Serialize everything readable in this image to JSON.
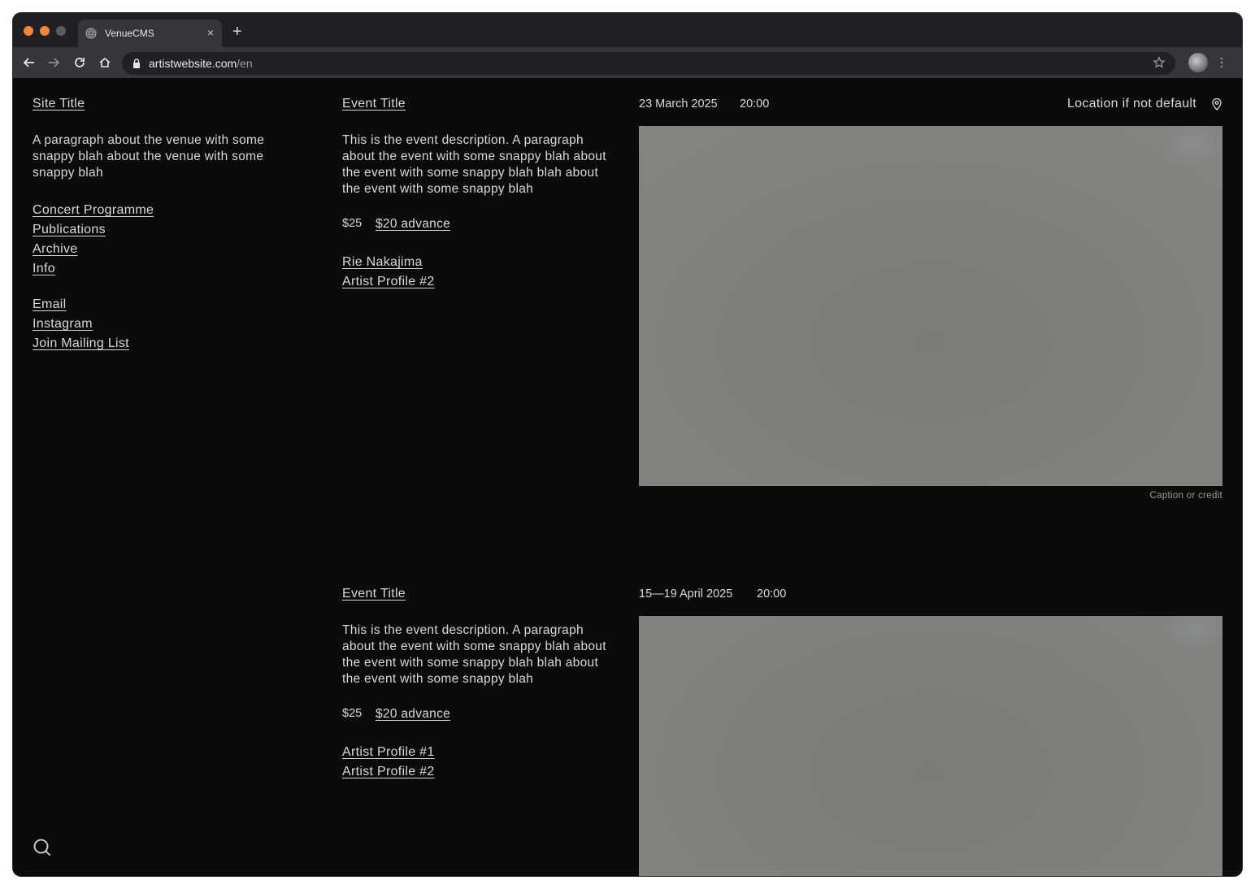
{
  "browser": {
    "tab_title": "VenueCMS",
    "tab_close": "×",
    "new_tab": "+",
    "url_host": "artistwebsite.com",
    "url_path": "/en"
  },
  "sidebar": {
    "site_title": "Site Title",
    "description": "A paragraph about the venue with some snappy blah about the venue with some snappy blah",
    "nav": [
      "Concert Programme",
      "Publications",
      "Archive",
      "Info"
    ],
    "social": [
      "Email",
      "Instagram",
      "Join Mailing List"
    ]
  },
  "events": [
    {
      "title": "Event Title",
      "date": "23 March 2025",
      "time": "20:00",
      "location": "Location if not default",
      "description": "This is the event description. A paragraph about the event with some snappy blah about the event with some snappy blah blah about the event with some snappy blah",
      "price": "$25",
      "advance": "$20 advance",
      "artists": [
        "Rie Nakajima",
        "Artist Profile #2"
      ],
      "caption": "Caption or credit"
    },
    {
      "title": "Event Title",
      "date": "15—19 April 2025",
      "time": "20:00",
      "description": "This is the event description. A paragraph about the event with some snappy blah about the event with some snappy blah blah about the event with some snappy blah",
      "price": "$25",
      "advance": "$20 advance",
      "artists": [
        "Artist Profile #1",
        "Artist Profile #2"
      ]
    }
  ],
  "colors": {
    "page_background": "#0a0c0c",
    "text": "#d6d9da",
    "accent_traffic": "#f2863c"
  }
}
